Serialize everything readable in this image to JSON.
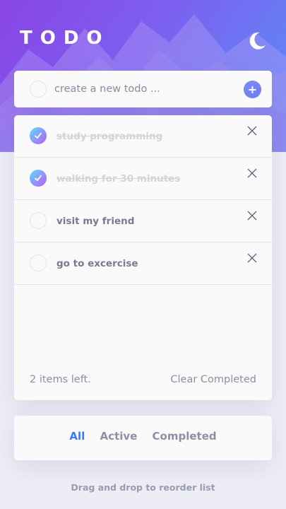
{
  "header": {
    "title": "TODO",
    "theme_icon": "moon-icon"
  },
  "create": {
    "placeholder": "create a new todo ...",
    "add_label": "+"
  },
  "todos": [
    {
      "text": "study programming",
      "completed": true
    },
    {
      "text": "walking for 30 minutes",
      "completed": true
    },
    {
      "text": "visit my friend",
      "completed": false
    },
    {
      "text": "go to excercise",
      "completed": false
    }
  ],
  "footer": {
    "items_left": "2 items left.",
    "clear_label": "Clear Completed"
  },
  "filters": {
    "all": "All",
    "active": "Active",
    "completed": "Completed",
    "selected": "All"
  },
  "hint": "Drag and drop to reorder list",
  "colors": {
    "accent": "#3a7bfd",
    "check_gradient_start": "#57ddff",
    "check_gradient_end": "#c058f3",
    "background": "#ededf6",
    "card": "#fafafa"
  }
}
